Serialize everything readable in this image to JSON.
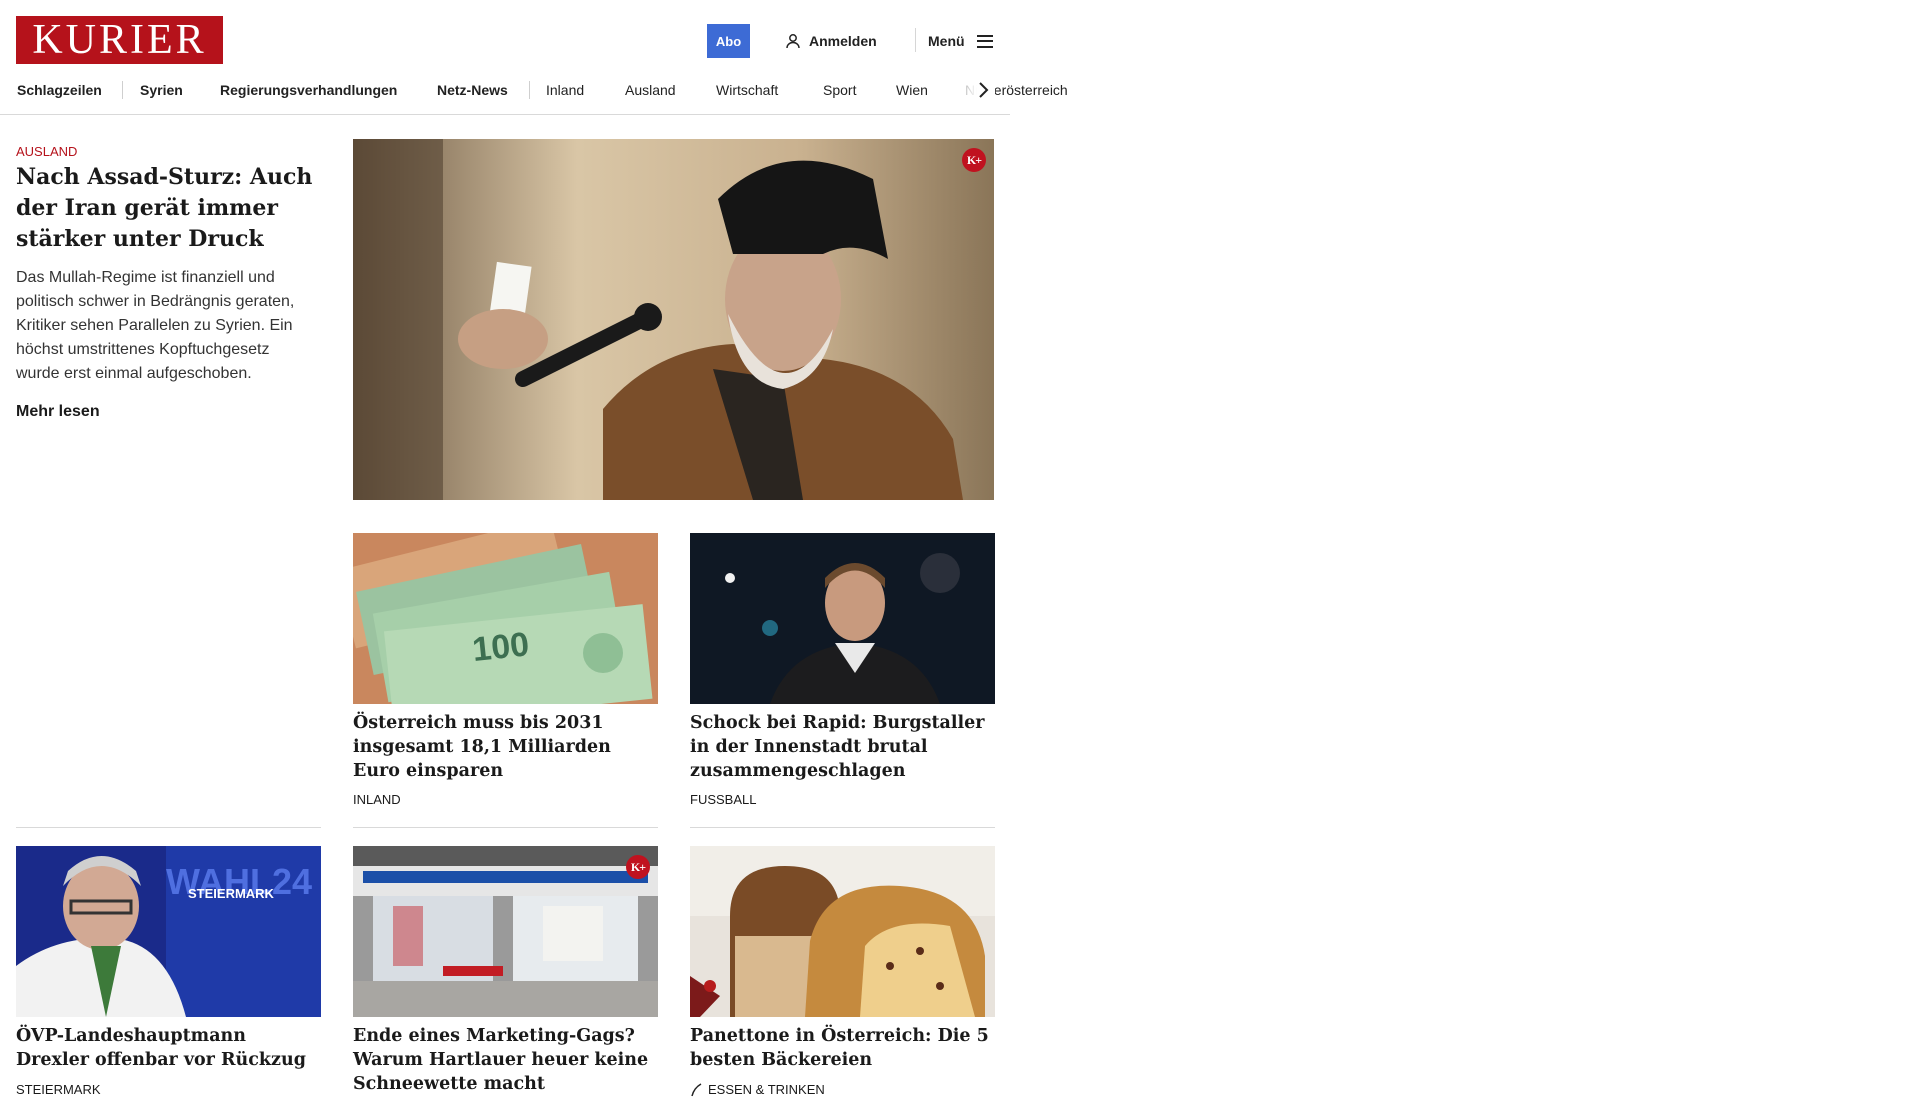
{
  "header": {
    "logo_text": "KURIER",
    "abo_label": "Abo",
    "login_label": "Anmelden",
    "menu_label": "Menü"
  },
  "nav": {
    "items": [
      "Schlagzeilen",
      "Syrien",
      "Regierungsverhandlungen",
      "Netz-News",
      "Inland",
      "Ausland",
      "Wirtschaft",
      "Sport",
      "Wien",
      "Niederösterreich"
    ],
    "next_icon": "chevron-right-icon"
  },
  "lead": {
    "kicker": "AUSLAND",
    "title": "Nach Assad-Sturz: Auch der Iran gerät immer stär­ker unter Druck",
    "teaser": "Das Mullah-Regime ist finanziell und politisch schwer in Bedrängnis geraten, Kritiker sehen Parallelen zu Syrien. Ein höchst umstrittenes Kopftuchgesetz wurde erst einmal aufgeschoben.",
    "more_label": "Mehr lesen",
    "premium_badge": "K+"
  },
  "cards": [
    {
      "title": "Österreich muss bis 2031 insge­samt 18,1 Milliarden Euro einsparen",
      "kicker": "INLAND",
      "image": "euro-banknotes"
    },
    {
      "title": "Schock bei Rapid: Burgstaller in der Innenstadt brutal zusammengeschlagen",
      "kicker": "FUSSBALL",
      "image": "football-player-portrait"
    },
    {
      "title": "ÖVP-Landeshauptmann Drexler offenbar vor Rückzug",
      "kicker": "STEIERMARK",
      "image": "election-evening",
      "image_text_1": "WAHL24",
      "image_text_2": "STEIERMARK"
    },
    {
      "title": "Ende eines Marketing-Gags? Warum Hartlauer heuer keine Schneewette macht",
      "kicker": "",
      "image": "store-front",
      "premium_badge": "K+"
    },
    {
      "title": "Panettone in Österreich: Die 5 bes­ten Bäckereien",
      "kicker": "ESSEN & TRINKEN",
      "image": "panettone",
      "kicker_icon": "feather-icon"
    }
  ],
  "colors": {
    "brand_red": "#b5121b",
    "abo_blue": "#3d6bd5"
  }
}
